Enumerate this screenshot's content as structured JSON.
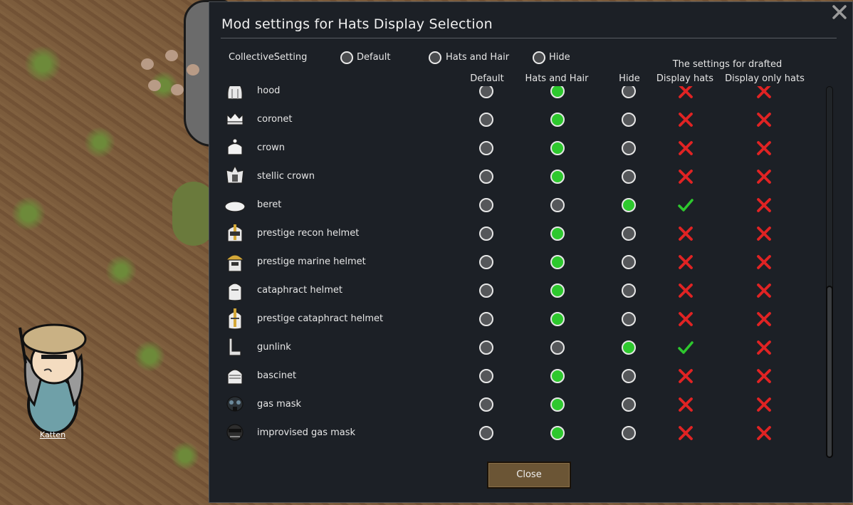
{
  "dialog": {
    "title": "Mod settings for Hats Display Selection",
    "collective_label": "CollectiveSetting",
    "collective_options": [
      "Default",
      "Hats and Hair",
      "Hide"
    ],
    "drafted_header": "The settings for drafted",
    "columns": [
      "Default",
      "Hats and Hair",
      "Hide",
      "Display hats",
      "Display only hats"
    ],
    "close_button": "Close"
  },
  "colonist": {
    "name": "Katten"
  },
  "colors": {
    "selected": "#2ec82e",
    "check": "#2ec82e",
    "cross": "#e02323",
    "button": "#6b5535"
  },
  "rows": [
    {
      "label": "hood",
      "icon": "hood-icon",
      "mode": "hats-and-hair",
      "display_hats": false,
      "display_only_hats": false
    },
    {
      "label": "coronet",
      "icon": "coronet-icon",
      "mode": "hats-and-hair",
      "display_hats": false,
      "display_only_hats": false
    },
    {
      "label": "crown",
      "icon": "crown-icon",
      "mode": "hats-and-hair",
      "display_hats": false,
      "display_only_hats": false
    },
    {
      "label": "stellic crown",
      "icon": "stellic-crown-icon",
      "mode": "hats-and-hair",
      "display_hats": false,
      "display_only_hats": false
    },
    {
      "label": "beret",
      "icon": "beret-icon",
      "mode": "hide",
      "display_hats": true,
      "display_only_hats": false
    },
    {
      "label": "prestige recon helmet",
      "icon": "recon-helmet-icon",
      "mode": "hats-and-hair",
      "display_hats": false,
      "display_only_hats": false
    },
    {
      "label": "prestige marine helmet",
      "icon": "marine-helmet-icon",
      "mode": "hats-and-hair",
      "display_hats": false,
      "display_only_hats": false
    },
    {
      "label": "cataphract helmet",
      "icon": "cataphract-helmet-icon",
      "mode": "hats-and-hair",
      "display_hats": false,
      "display_only_hats": false
    },
    {
      "label": "prestige cataphract helmet",
      "icon": "prestige-cataphract-helmet-icon",
      "mode": "hats-and-hair",
      "display_hats": false,
      "display_only_hats": false
    },
    {
      "label": "gunlink",
      "icon": "gunlink-icon",
      "mode": "hide",
      "display_hats": true,
      "display_only_hats": false
    },
    {
      "label": "bascinet",
      "icon": "bascinet-icon",
      "mode": "hats-and-hair",
      "display_hats": false,
      "display_only_hats": false
    },
    {
      "label": "gas mask",
      "icon": "gas-mask-icon",
      "mode": "hats-and-hair",
      "display_hats": false,
      "display_only_hats": false
    },
    {
      "label": "improvised gas mask",
      "icon": "improvised-gas-mask-icon",
      "mode": "hats-and-hair",
      "display_hats": false,
      "display_only_hats": false
    }
  ]
}
